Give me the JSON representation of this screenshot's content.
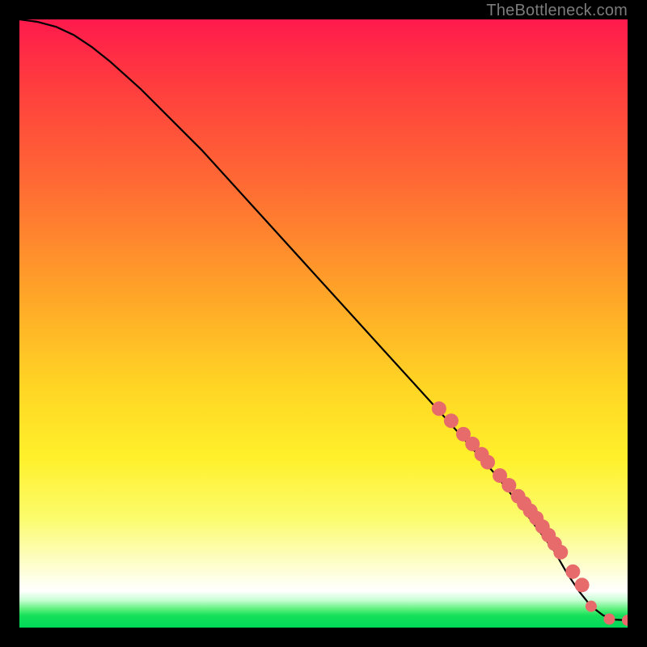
{
  "watermark": "TheBottleneck.com",
  "chart_data": {
    "type": "line",
    "title": "",
    "xlabel": "",
    "ylabel": "",
    "xlim": [
      0,
      100
    ],
    "ylim": [
      0,
      100
    ],
    "grid": false,
    "series": [
      {
        "name": "curve",
        "x": [
          0,
          3,
          6,
          9,
          12,
          15,
          20,
          30,
          40,
          50,
          60,
          70,
          78,
          82,
          85,
          88,
          90,
          92,
          94,
          96,
          98,
          100
        ],
        "y": [
          100,
          99.6,
          98.8,
          97.4,
          95.4,
          93.0,
          88.5,
          78.5,
          67.5,
          56.5,
          45.5,
          34.5,
          25.5,
          20.5,
          16.5,
          12.5,
          9.0,
          6.0,
          3.5,
          2.0,
          1.3,
          1.2
        ]
      }
    ],
    "markers": {
      "name": "dots",
      "color": "#e86b6b",
      "radius_main": 9,
      "radius_tail": 7,
      "x": [
        69,
        71,
        73,
        74.5,
        76,
        77,
        79,
        80.5,
        82,
        83,
        84,
        85,
        86,
        87,
        88,
        89,
        91,
        92.5,
        94,
        97,
        100
      ],
      "y": [
        36,
        34,
        31.8,
        30.2,
        28.5,
        27.2,
        25,
        23.4,
        21.6,
        20.4,
        19.2,
        18,
        16.6,
        15.2,
        13.8,
        12.4,
        9.2,
        7.0,
        3.5,
        1.4,
        1.2
      ]
    }
  }
}
